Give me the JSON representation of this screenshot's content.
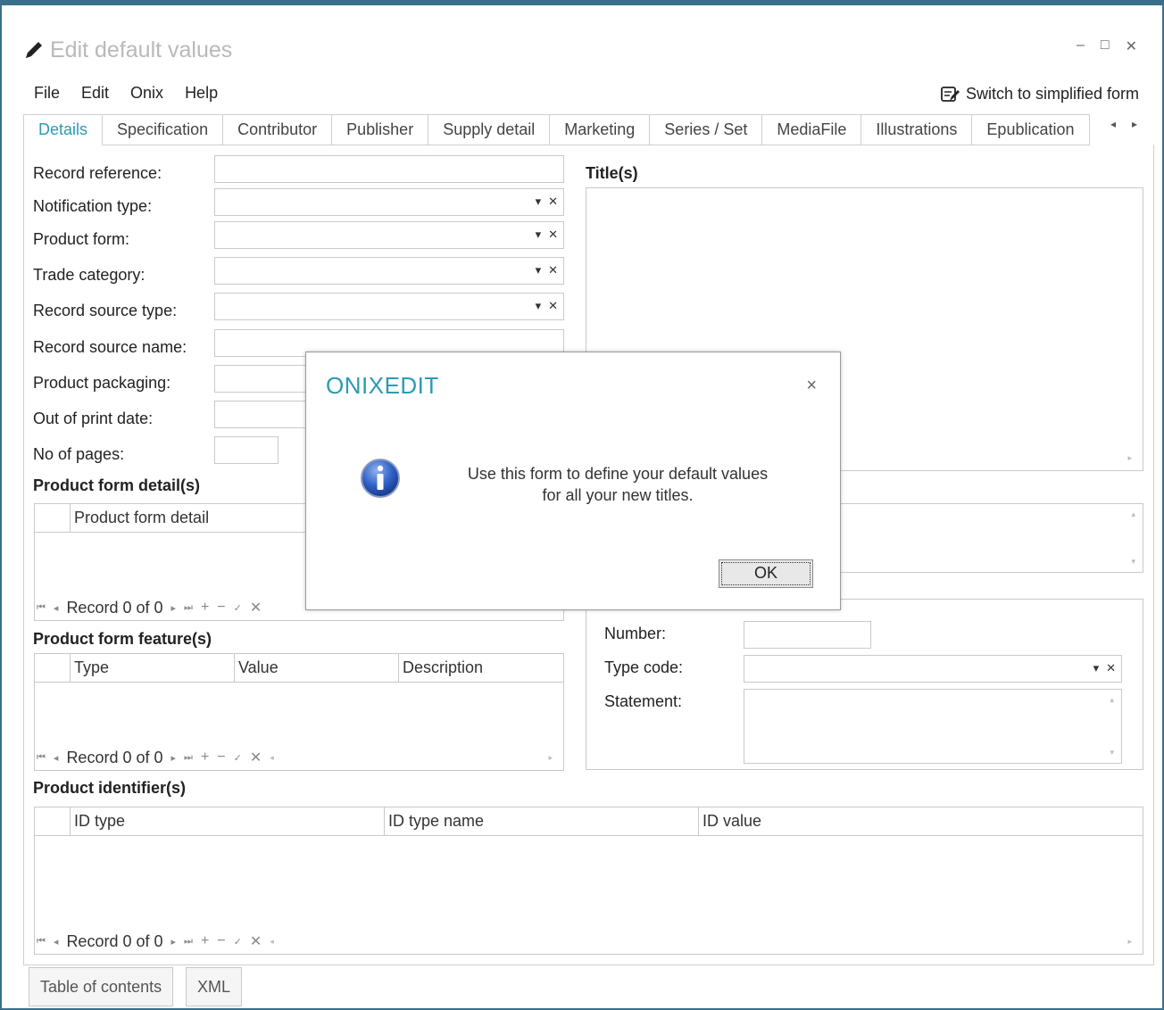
{
  "window": {
    "title": "Edit default values",
    "minimize": "–",
    "maximize": "□",
    "close": "✕"
  },
  "menu": [
    "File",
    "Edit",
    "Onix",
    "Help"
  ],
  "switch_label": "Switch to simplified form",
  "tabs": [
    "Details",
    "Specification",
    "Contributor",
    "Publisher",
    "Supply detail",
    "Marketing",
    "Series / Set",
    "MediaFile",
    "Illustrations",
    "Epublication"
  ],
  "tab_arrows": [
    "◂",
    "▸"
  ],
  "fields": {
    "record_reference": "Record reference:",
    "notification_type": "Notification type:",
    "product_form": "Product form:",
    "trade_category": "Trade category:",
    "record_source_type": "Record source type:",
    "record_source_name": "Record source name:",
    "product_packaging": "Product packaging:",
    "out_of_print_date": "Out of print date:",
    "no_of_pages": "No of pages:"
  },
  "titles_section": "Title(s)",
  "product_form_detail": {
    "section": "Product form detail(s)",
    "columns": [
      "Product form detail"
    ]
  },
  "product_form_feature": {
    "section": "Product form feature(s)",
    "columns": [
      "Type",
      "Value",
      "Description"
    ]
  },
  "product_identifier": {
    "section": "Product identifier(s)",
    "columns": [
      "ID type",
      "ID type name",
      "ID value"
    ]
  },
  "nav": {
    "record": "Record 0 of 0",
    "first": "⏮",
    "prev": "◂",
    "next": "▸",
    "last": "⏭",
    "add": "+",
    "remove": "−",
    "confirm": "✓",
    "cancel": "✕"
  },
  "edition": {
    "number_label": "Number:",
    "type_code_label": "Type code:",
    "statement_label": "Statement:"
  },
  "bottom_buttons": [
    "Table of contents",
    "XML"
  ],
  "dialog": {
    "title": "ONIXEDIT",
    "close": "×",
    "message_line1": "Use this form to define your default values",
    "message_line2": "for all your new titles.",
    "ok_label": "OK"
  }
}
